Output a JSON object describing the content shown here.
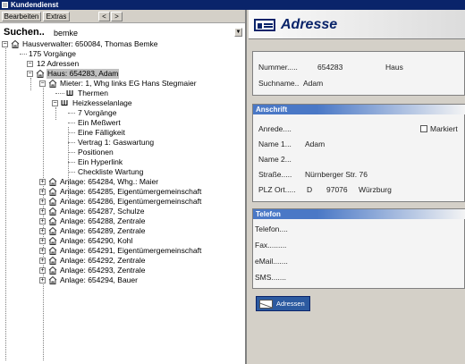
{
  "window": {
    "title": "Kundendienst"
  },
  "toolbar": {
    "edit": "Bearbeiten",
    "extras": "Extras",
    "prev": "<",
    "next": ">"
  },
  "search": {
    "label": "Suchen..",
    "value": "bemke"
  },
  "tree": {
    "root": "Hausverwalter: 650084, Thomas Bemke",
    "vorgaenge": "175 Vorgänge",
    "adressen": "12 Adressen",
    "haus": "Haus: 654283, Adam",
    "mieter": "Mieter: 1, Whg links EG Hans Stegmaier",
    "thermen": "Thermen",
    "heiz": "Heizkesselanlage",
    "heiz_children": [
      "7 Vorgänge",
      "Ein Meßwert",
      "Eine Fälligkeit",
      "Vertrag 1: Gaswartung",
      "Positionen",
      "Ein Hyperlink",
      "Checkliste Wartung"
    ],
    "anlagen": [
      "Anlage: 654284, Whg.: Maier",
      "Anlage: 654285, Eigentümergemeinschaft",
      "Anlage: 654286, Eigentümergemeinschaft",
      "Anlage: 654287, Schulze",
      "Anlage: 654288, Zentrale",
      "Anlage: 654289, Zentrale",
      "Anlage: 654290, Kohl",
      "Anlage: 654291, Eigentümergemeinschaft",
      "Anlage: 654292, Zentrale",
      "Anlage: 654293, Zentrale",
      "Anlage: 654294, Bauer"
    ]
  },
  "detail": {
    "title": "Adresse",
    "nummer_label": "Nummer.....",
    "nummer_value": "654283",
    "typ_value": "Haus",
    "suchname_label": "Suchname..",
    "suchname_value": "Adam",
    "anschrift_header": "Anschrift",
    "anrede_label": "Anrede....",
    "markiert_label": "Markiert",
    "name1_label": "Name 1...",
    "name1_value": "Adam",
    "name2_label": "Name 2...",
    "strasse_label": "Straße.....",
    "strasse_value": "Nürnberger Str. 76",
    "plz_label": "PLZ Ort.....",
    "land_value": "D",
    "plz_value": "97076",
    "ort_value": "Würzburg",
    "telefon_header": "Telefon",
    "telefon_label": "Telefon....",
    "fax_label": "Fax.........",
    "email_label": "eMail.......",
    "sms_label": "SMS.......",
    "adressen_button": "Adressen"
  },
  "colors": {
    "titlebar": "#0a246a",
    "section_header": "#4a78c6",
    "button": "#2c5aa0"
  }
}
